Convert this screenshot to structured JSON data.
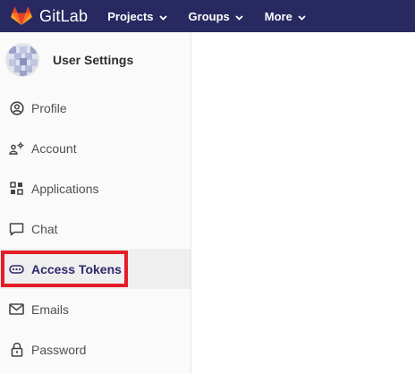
{
  "navbar": {
    "brand_name": "GitLab",
    "brand_icon": "gitlab-tanuki-icon",
    "menus": [
      {
        "label": "Projects",
        "icon": "chevron-down-icon"
      },
      {
        "label": "Groups",
        "icon": "chevron-down-icon"
      },
      {
        "label": "More",
        "icon": "chevron-down-icon"
      }
    ],
    "background": "#292961"
  },
  "sidebar": {
    "title": "User Settings",
    "avatar_icon": "identicon-avatar",
    "items": [
      {
        "label": "Profile",
        "icon": "user-circle-icon",
        "active": false
      },
      {
        "label": "Account",
        "icon": "account-gear-icon",
        "active": false
      },
      {
        "label": "Applications",
        "icon": "applications-grid-icon",
        "active": false
      },
      {
        "label": "Chat",
        "icon": "chat-bubble-icon",
        "active": false
      },
      {
        "label": "Access Tokens",
        "icon": "token-icon",
        "active": true
      },
      {
        "label": "Emails",
        "icon": "envelope-icon",
        "active": false
      },
      {
        "label": "Password",
        "icon": "lock-icon",
        "active": false
      }
    ]
  },
  "colors": {
    "highlight": "#e41d27",
    "active_text": "#2f2a6b"
  }
}
